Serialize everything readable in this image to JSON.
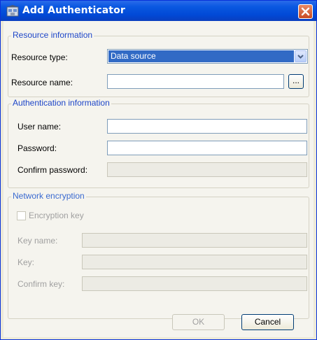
{
  "window": {
    "title": "Add Authenticator"
  },
  "resource": {
    "legend": "Resource information",
    "type_label": "Resource type:",
    "type_value": "Data source",
    "name_label": "Resource name:",
    "name_value": "",
    "browse_label": "..."
  },
  "auth": {
    "legend": "Authentication information",
    "user_label": "User name:",
    "user_value": "",
    "password_label": "Password:",
    "password_value": "",
    "confirm_label": "Confirm password:",
    "confirm_value": ""
  },
  "network": {
    "legend": "Network encryption",
    "checkbox_label": "Encryption key",
    "key_name_label": "Key name:",
    "key_label": "Key:",
    "confirm_key_label": "Confirm key:"
  },
  "footer": {
    "ok_label": "OK",
    "cancel_label": "Cancel"
  },
  "colors": {
    "title_bar": "#0a58e1",
    "selection": "#316ac5",
    "legend_text": "#1e46c8",
    "close_button": "#d6562c"
  },
  "icons": {
    "title": "authenticator-icon",
    "close": "close-icon",
    "dropdown": "chevron-down-icon"
  }
}
